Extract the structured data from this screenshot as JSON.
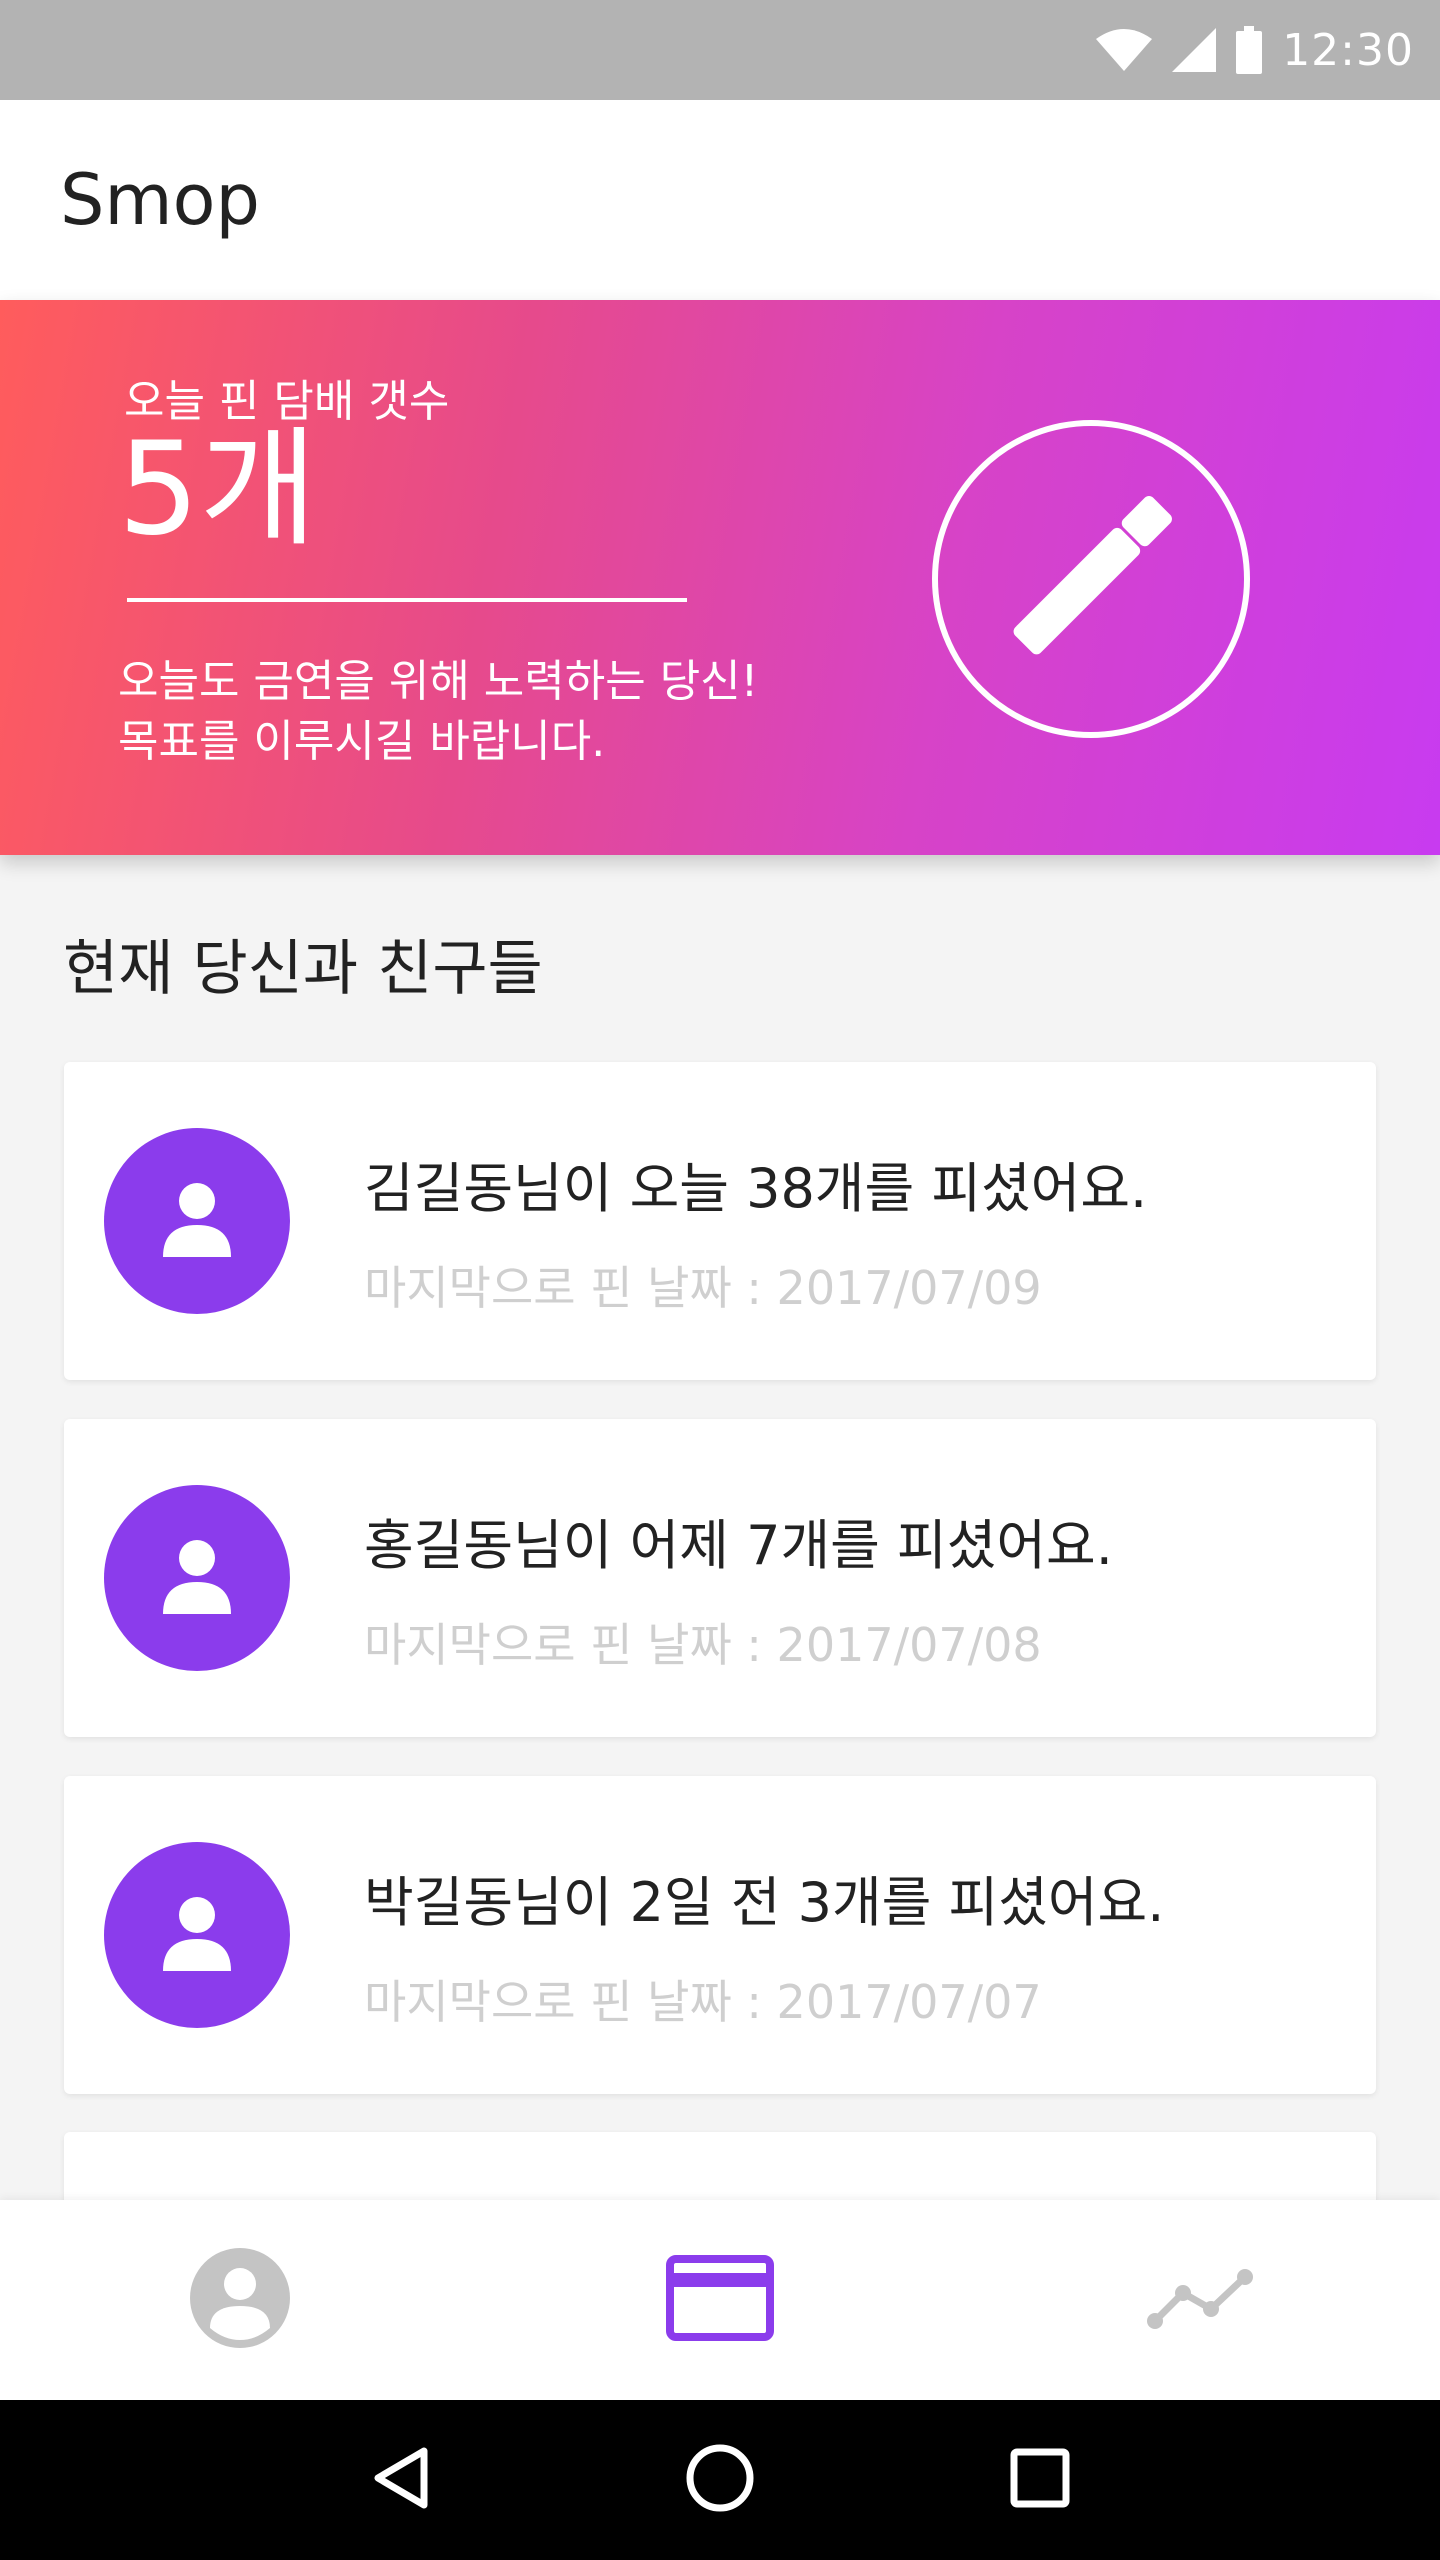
{
  "status_bar": {
    "time": "12:30",
    "icons": [
      "wifi-icon",
      "cell-signal-icon",
      "battery-icon"
    ]
  },
  "app_bar": {
    "title": "Smop"
  },
  "hero": {
    "label": "오늘 핀 담배 갯수",
    "count": "5개",
    "message_line1": "오늘도 금연을 위해 노력하는 당신!",
    "message_line2": "목표를 이루시길 바랍니다.",
    "action_icon": "cigarette-icon",
    "gradient_start": "#ff5c5c",
    "gradient_end": "#c83bf0"
  },
  "friends_section": {
    "title": "현재 당신과 친구들",
    "items": [
      {
        "title": "김길동님이 오늘 38개를 피셨어요.",
        "subtitle": "마지막으로 핀 날짜 : 2017/07/09",
        "icon": "person-icon"
      },
      {
        "title": "홍길동님이 어제 7개를 피셨어요.",
        "subtitle": "마지막으로 핀 날짜 : 2017/07/08",
        "icon": "person-icon"
      },
      {
        "title": "박길동님이 2일 전 3개를 피셨어요.",
        "subtitle": "마지막으로 핀 날짜 : 2017/07/07",
        "icon": "person-icon"
      }
    ]
  },
  "bottom_nav": {
    "items": [
      {
        "icon": "account-circle-icon",
        "active": false
      },
      {
        "icon": "card-icon",
        "active": true
      },
      {
        "icon": "trend-line-icon",
        "active": false
      }
    ]
  },
  "colors": {
    "accent": "#8b3cec",
    "inactive_icon": "#c4c4c4",
    "status_bar": "#b3b3b3"
  }
}
